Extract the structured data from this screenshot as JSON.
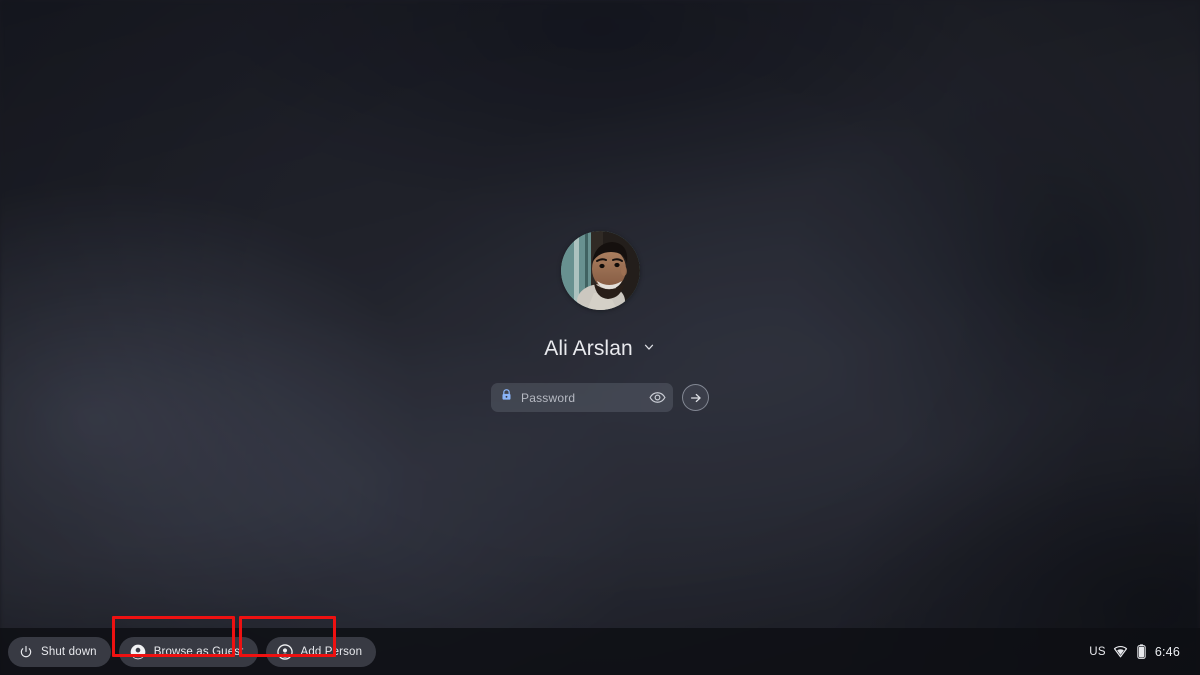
{
  "wallpaper": {
    "description": "blurred dark indoor photo",
    "dominant_color": "#2a2b35",
    "dark_accent": "#1d1e28"
  },
  "login_pod": {
    "avatar": {
      "icon": "user-avatar-photo",
      "alt": "Ali Arslan profile photo"
    },
    "user_name": "Ali Arslan",
    "dropdown_icon": "chevron-down-icon",
    "password": {
      "placeholder": "Password",
      "value": "",
      "lock_icon": "lock-icon",
      "lock_color": "#8ab4f8",
      "visibility_icon": "eye-icon",
      "submit_icon": "arrow-right-icon"
    }
  },
  "shelf": {
    "buttons": [
      {
        "id": "shut-down",
        "label": "Shut down",
        "icon": "power-icon",
        "highlighted": false
      },
      {
        "id": "browse-as-guest",
        "label": "Browse as Guest",
        "icon": "person-icon",
        "highlighted": true
      },
      {
        "id": "add-person",
        "label": "Add Person",
        "icon": "add-person-icon",
        "highlighted": true
      }
    ],
    "highlight_color": "#ee1111",
    "status_tray": {
      "keyboard_locale": "US",
      "network_icon": "wifi-icon",
      "battery_icon": "battery-icon",
      "time": "6:46"
    }
  }
}
